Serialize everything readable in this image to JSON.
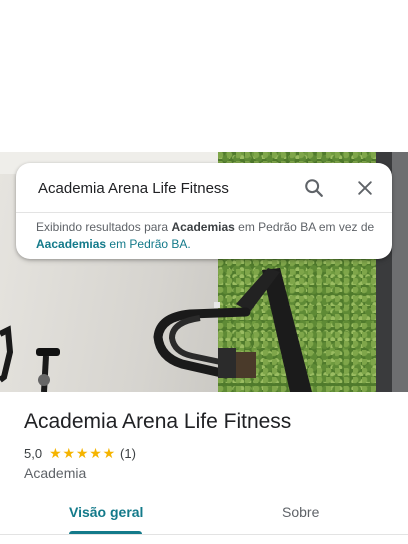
{
  "search": {
    "query": "Academia Arena Life Fitness",
    "search_icon": "search-icon",
    "close_icon": "close-icon"
  },
  "suggestion": {
    "prefix": "Exibindo resultados para",
    "shown_term": "Academias",
    "shown_location": "em Pedrão BA em vez de",
    "original_term": "Aacademias",
    "original_location": "em Pedrão BA."
  },
  "place": {
    "name": "Academia Arena Life Fitness",
    "rating": "5,0",
    "stars": 5,
    "review_count": "(1)",
    "category": "Academia"
  },
  "tabs": [
    {
      "label": "Visão geral",
      "active": true
    },
    {
      "label": "Sobre",
      "active": false
    }
  ],
  "colors": {
    "accent": "#137a8a",
    "star": "#f5b400"
  }
}
